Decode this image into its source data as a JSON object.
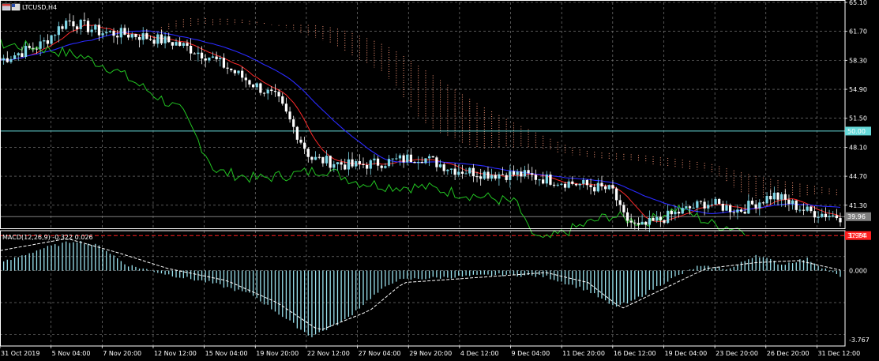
{
  "window": {
    "title": "LTCUSD,H4"
  },
  "macd_label": "MACD(12,26,9) -0.322 0.026",
  "colors": {
    "background": "#000000",
    "grid": "#8c8c8c",
    "bull": "#7fd8e8",
    "bear": "#ffffff",
    "tenkan": "#ff2a2a",
    "kijun": "#2a2aff",
    "chikou": "#22c522",
    "cloud": "#ff9a7a",
    "level50": "#66d9d9",
    "red_level": "#ff2020",
    "macd_hist": "#9be3ef",
    "macd_signal": "#ffffff"
  },
  "chart_data": [
    {
      "type": "candlestick",
      "symbol": "LTCUSD",
      "timeframe": "H4",
      "indicators": [
        "Ichimoku Kinko Hyo"
      ],
      "ylim": [
        38.5,
        65.1
      ],
      "yticks": [
        "65.10",
        "61.70",
        "58.30",
        "54.90",
        "51.50",
        "48.10",
        "44.70",
        "41.30"
      ],
      "xticks": [
        "31 Oct 2019",
        "5 Nov 04:00",
        "7 Nov 20:00",
        "12 Nov 12:00",
        "15 Nov 04:00",
        "19 Nov 20:00",
        "22 Nov 12:00",
        "27 Nov 04:00",
        "29 Nov 20:00",
        "4 Dec 12:00",
        "9 Dec 04:00",
        "11 Dec 20:00",
        "16 Dec 12:00",
        "19 Dec 04:00",
        "23 Dec 20:00",
        "26 Dec 20:00",
        "31 Dec 12:00"
      ],
      "horizontal_lines": [
        {
          "value": 50.0,
          "label": "50.00",
          "color": "#66d9d9"
        },
        {
          "value": 39.96,
          "label": "39.96",
          "color": "#808080"
        },
        {
          "value": 37.74,
          "label": "37.74",
          "color": "#ff2020"
        }
      ],
      "close_path": [
        [
          0,
          58.3
        ],
        [
          0.05,
          60.2
        ],
        [
          0.08,
          63.0
        ],
        [
          0.12,
          61.6
        ],
        [
          0.16,
          61.3
        ],
        [
          0.21,
          60.3
        ],
        [
          0.25,
          58.7
        ],
        [
          0.3,
          55.6
        ],
        [
          0.33,
          53.8
        ],
        [
          0.37,
          46.8
        ],
        [
          0.42,
          45.9
        ],
        [
          0.46,
          46.4
        ],
        [
          0.5,
          47.0
        ],
        [
          0.54,
          45.5
        ],
        [
          0.58,
          45.0
        ],
        [
          0.62,
          44.9
        ],
        [
          0.66,
          44.2
        ],
        [
          0.7,
          43.6
        ],
        [
          0.73,
          43.0
        ],
        [
          0.74,
          40.1
        ],
        [
          0.76,
          38.6
        ],
        [
          0.8,
          40.2
        ],
        [
          0.84,
          41.6
        ],
        [
          0.88,
          40.7
        ],
        [
          0.92,
          42.5
        ],
        [
          0.96,
          40.6
        ],
        [
          1.0,
          39.96
        ]
      ]
    },
    {
      "type": "bar",
      "name": "MACD(12,26,9)",
      "values_label": "-0.322 0.026",
      "ylim": [
        -3.767,
        1.994
      ],
      "yticks": [
        "1.994",
        "0.000",
        "-3.767"
      ],
      "histogram_path": [
        [
          0,
          0.35
        ],
        [
          0.05,
          1.1
        ],
        [
          0.09,
          1.5
        ],
        [
          0.12,
          1.2
        ],
        [
          0.15,
          0.3
        ],
        [
          0.2,
          -0.2
        ],
        [
          0.25,
          -0.6
        ],
        [
          0.3,
          -1.2
        ],
        [
          0.34,
          -2.4
        ],
        [
          0.37,
          -3.3
        ],
        [
          0.41,
          -2.5
        ],
        [
          0.44,
          -1.4
        ],
        [
          0.47,
          -0.5
        ],
        [
          0.5,
          -0.4
        ],
        [
          0.55,
          -0.3
        ],
        [
          0.6,
          -0.2
        ],
        [
          0.65,
          -0.3
        ],
        [
          0.7,
          -1.0
        ],
        [
          0.73,
          -1.8
        ],
        [
          0.75,
          -1.6
        ],
        [
          0.79,
          -0.6
        ],
        [
          0.83,
          0.2
        ],
        [
          0.87,
          0.1
        ],
        [
          0.9,
          0.8
        ],
        [
          0.93,
          0.3
        ],
        [
          0.96,
          0.6
        ],
        [
          1.0,
          -0.322
        ]
      ],
      "signal_path": [
        [
          0,
          1.0
        ],
        [
          0.08,
          1.6
        ],
        [
          0.14,
          0.9
        ],
        [
          0.2,
          0.1
        ],
        [
          0.27,
          -0.5
        ],
        [
          0.33,
          -1.6
        ],
        [
          0.38,
          -3.0
        ],
        [
          0.44,
          -2.0
        ],
        [
          0.48,
          -0.6
        ],
        [
          0.55,
          -0.4
        ],
        [
          0.65,
          -0.1
        ],
        [
          0.7,
          -0.6
        ],
        [
          0.74,
          -1.9
        ],
        [
          0.79,
          -0.9
        ],
        [
          0.84,
          0.1
        ],
        [
          0.9,
          0.4
        ],
        [
          0.95,
          0.5
        ],
        [
          1.0,
          0.026
        ]
      ]
    }
  ]
}
